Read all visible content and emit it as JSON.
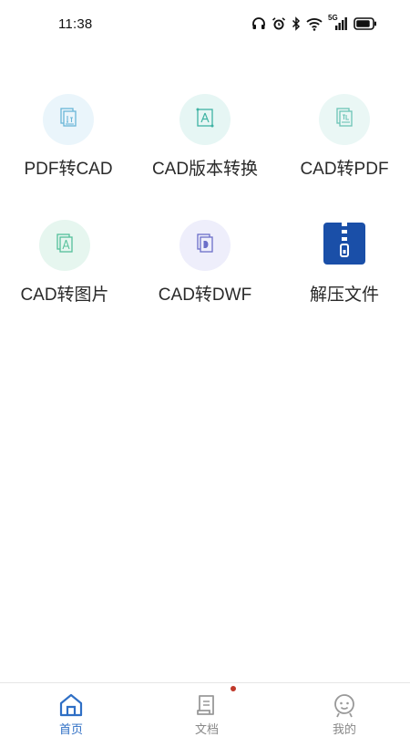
{
  "status_bar": {
    "time": "11:38",
    "icons": [
      "headphones-icon",
      "alarm-icon",
      "bluetooth-icon",
      "wifi-icon",
      "signal-5g-icon",
      "battery-icon"
    ],
    "network_label": "5G"
  },
  "tools": [
    {
      "label": "PDF转CAD",
      "icon": "pdf-to-cad-icon",
      "bg": "#eaf5fb",
      "color": "#6ab6d8"
    },
    {
      "label": "CAD版本转换",
      "icon": "cad-version-icon",
      "bg": "#e6f6f4",
      "color": "#3fb3a3"
    },
    {
      "label": "CAD转PDF",
      "icon": "cad-to-pdf-icon",
      "bg": "#eaf7f5",
      "color": "#6cc4b6"
    },
    {
      "label": "CAD转图片",
      "icon": "cad-to-image-icon",
      "bg": "#e6f6ef",
      "color": "#54c09a"
    },
    {
      "label": "CAD转DWF",
      "icon": "cad-to-dwf-icon",
      "bg": "#eeeefb",
      "color": "#6b6ec9"
    },
    {
      "label": "解压文件",
      "icon": "unzip-icon",
      "bg": "#1a4fa8",
      "color": "#ffffff"
    }
  ],
  "tabbar": {
    "items": [
      {
        "label": "首页",
        "icon": "home-icon",
        "active": true
      },
      {
        "label": "文档",
        "icon": "document-icon",
        "active": false,
        "badge": true
      },
      {
        "label": "我的",
        "icon": "profile-icon",
        "active": false
      }
    ]
  },
  "colors": {
    "accent": "#2f6fc5",
    "badge": "#c0392b",
    "inactive": "#888888"
  }
}
